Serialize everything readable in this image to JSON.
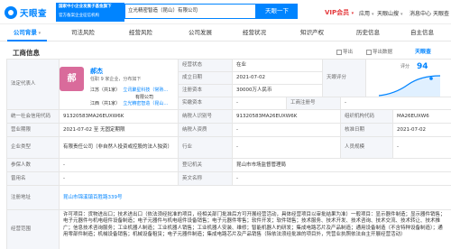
{
  "header": {
    "logo_text": "天眼查",
    "banner_line1": "国家中小企业发展子基金旗下",
    "banner_line2": "官方备案企业征信机构",
    "search_value": "立光精密智造（昆山）有限公司",
    "search_button": "天眼一下",
    "vip_label": "VIP会员",
    "nav": [
      "应用",
      "天眼山搜",
      "消息中心",
      "天眼查"
    ]
  },
  "tabs": [
    {
      "label": "公司背景",
      "active": true,
      "dropdown": true
    },
    {
      "label": "司法风险",
      "active": false,
      "dropdown": false
    },
    {
      "label": "经营风险",
      "active": false,
      "dropdown": false
    },
    {
      "label": "公司发展",
      "active": false,
      "dropdown": false
    },
    {
      "label": "经营状况",
      "active": false,
      "dropdown": false
    },
    {
      "label": "知识产权",
      "active": false,
      "dropdown": false
    },
    {
      "label": "历史信息",
      "active": false,
      "dropdown": false
    },
    {
      "label": "自主信息",
      "active": false,
      "dropdown": false
    }
  ],
  "section": {
    "title": "工商信息",
    "action_export": "导出",
    "action_share": "导出数据",
    "brand": "天眼查"
  },
  "legal_rep": {
    "label": "法定代表人",
    "avatar_char": "郝",
    "name": "郝杰",
    "sub": "任职 9 家企业，分布如下",
    "row1_a": "江苏（共1家）",
    "row1_b": "立讯聚星科技（常熟…",
    "row1_c": "有限公司",
    "row2_a": "江西（共1家）",
    "row2_b": "立光精密智造（昆山…"
  },
  "info": {
    "status_label": "经营状态",
    "status_value": "在业",
    "established_label": "成立日期",
    "established_value": "2021-07-02",
    "capital_label": "注册资本",
    "capital_value": "30000万人民币",
    "paidin_label": "实缴资本",
    "paidin_value": "-",
    "score_label": "天眼评分",
    "score_value": "94",
    "score_note": "评分",
    "regno_label": "工商注册号",
    "regno_value": "-",
    "credit_label": "统一社会信用代码",
    "credit_value": "91320583MA26EUXW6K",
    "taxid_label": "纳税人识别号",
    "taxid_value": "91320583MA26EUXW6K",
    "orgcode_label": "组织机构代码",
    "orgcode_value": "MA26EUXW6",
    "term_label": "营业期限",
    "term_value": "2021-07-02 至 无固定期限",
    "taxpayer_label": "纳税人资质",
    "taxpayer_value": "-",
    "approved_label": "核准日期",
    "approved_value": "2021-07-02",
    "type_label": "企业类型",
    "type_value": "有限责任公司（非自然人投资或控股的法人独资）",
    "industry_label": "行业",
    "industry_value": "-",
    "staff_label": "人员规模",
    "staff_value": "-",
    "insured_label": "参保人数",
    "insured_value": "-",
    "authority_label": "登记机关",
    "authority_value": "昆山市市场监督管理局",
    "former_label": "曾用名",
    "former_value": "-",
    "en_label": "英文名称",
    "en_value": "-",
    "addr_label": "注册地址",
    "addr_value": "昆山市锦溪镇百胜路339号",
    "scope_label": "经营范围",
    "scope_value": "许可项目：货物进出口；技术进出口（依法须经批准的项目，经相关部门批准后方可开展经营活动，具体经营项目以审批结果为准）一般项目：显示器件制造；显示器件销售；电子元器件与机电组件设备制造；电子元器件与机电组件设备销售；电子元器件零售；软件开发；软件销售；技术服务、技术开发、技术咨询、技术交流、技术转让、技术推广；信息技术咨询服务；工业机器人制造；工业机器人销售；工业机器人安装、维修；智能机器人的研发；集成电路芯片及产品制造；通用设备制造（不含特种设备制造）；通用零部件制造；机械设备销售；机械设备租赁；电子元器件制造；集成电路芯片及产品销售（除依法须经批准的项目外，凭营业执照依法自主开展经营活动）"
  },
  "colors": {
    "accent": "#0084ff",
    "vip": "#e4393c",
    "avatar": "#d96b9b",
    "label_bg": "#f4f6fa"
  }
}
